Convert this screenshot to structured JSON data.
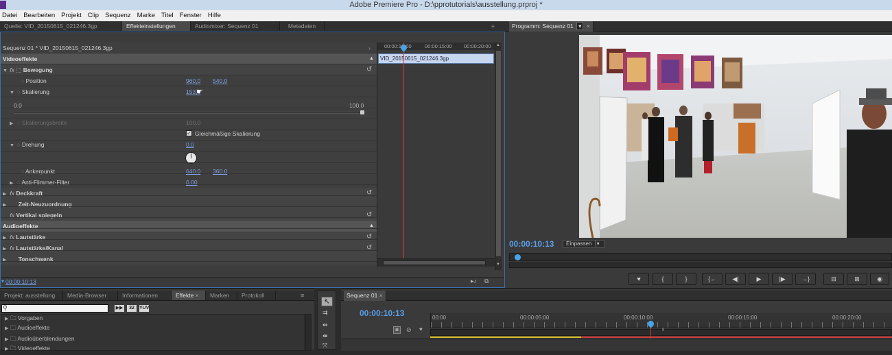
{
  "window": {
    "title": "Adobe Premiere Pro - D:\\pprotutorials\\ausstellung.prproj *"
  },
  "menu": [
    "Datei",
    "Bearbeiten",
    "Projekt",
    "Clip",
    "Sequenz",
    "Marke",
    "Titel",
    "Fenster",
    "Hilfe"
  ],
  "top_tabs": [
    "Quelle: VID_20150615_021246.3gp",
    "Effekteinstellungen",
    "Audiomixer: Sequenz 01",
    "Metadaten"
  ],
  "effects": {
    "sequence_label": "Sequenz 01 * VID_20150615_021246.3gp",
    "timeline_ticks": [
      "00:00:10:00",
      "00:00:15:00",
      "00:00:20:00"
    ],
    "clip_name": "VID_20150615_021246.3gp",
    "video_section": "Videoeffekte",
    "motion": "Bewegung",
    "position_label": "Position",
    "position_x": "960,0",
    "position_y": "540,0",
    "scale_label": "Skalierung",
    "scale_value": "153,0",
    "slider_min": "0.0",
    "slider_max": "100.0",
    "scale_width_label": "Skalierungsbreite",
    "scale_width_value": "100,0",
    "uniform_scale": "Gleichmäßige Skalierung",
    "rotation_label": "Drehung",
    "rotation_value": "0,0",
    "anchor_label": "Ankerpunkt",
    "anchor_x": "640,0",
    "anchor_y": "360,0",
    "flicker_label": "Anti-Flimmer-Filter",
    "flicker_value": "0,00",
    "opacity": "Deckkraft",
    "time_remap": "Zeit-Neuzuordnung",
    "vertical_flip": "Vertikal spiegeln",
    "audio_section": "Audioeffekte",
    "volume": "Lautstärke",
    "channel_volume": "Lautstärke/Kanal",
    "panner": "Tonschwenk",
    "timecode": "00:00:10:13"
  },
  "program": {
    "tab": "Programm: Sequenz 01",
    "timecode": "00:00:10:13",
    "fit": "Einpassen"
  },
  "project_tabs": [
    "Projekt: ausstellung",
    "Media-Browser",
    "Informationen",
    "Effekte",
    "Marken",
    "Protokoll"
  ],
  "project_icons": [
    "32",
    "YUV"
  ],
  "effects_tree": [
    "Vorgaben",
    "Audioeffekte",
    "Audioüberblendungen",
    "Videoeffekte"
  ],
  "timeline": {
    "tab": "Sequenz 01",
    "timecode": "00:00:10:13",
    "ticks": [
      "00:00",
      "00:00:05:00",
      "00:00:10:00",
      "00:00:15:00",
      "00:00:20:00"
    ]
  }
}
